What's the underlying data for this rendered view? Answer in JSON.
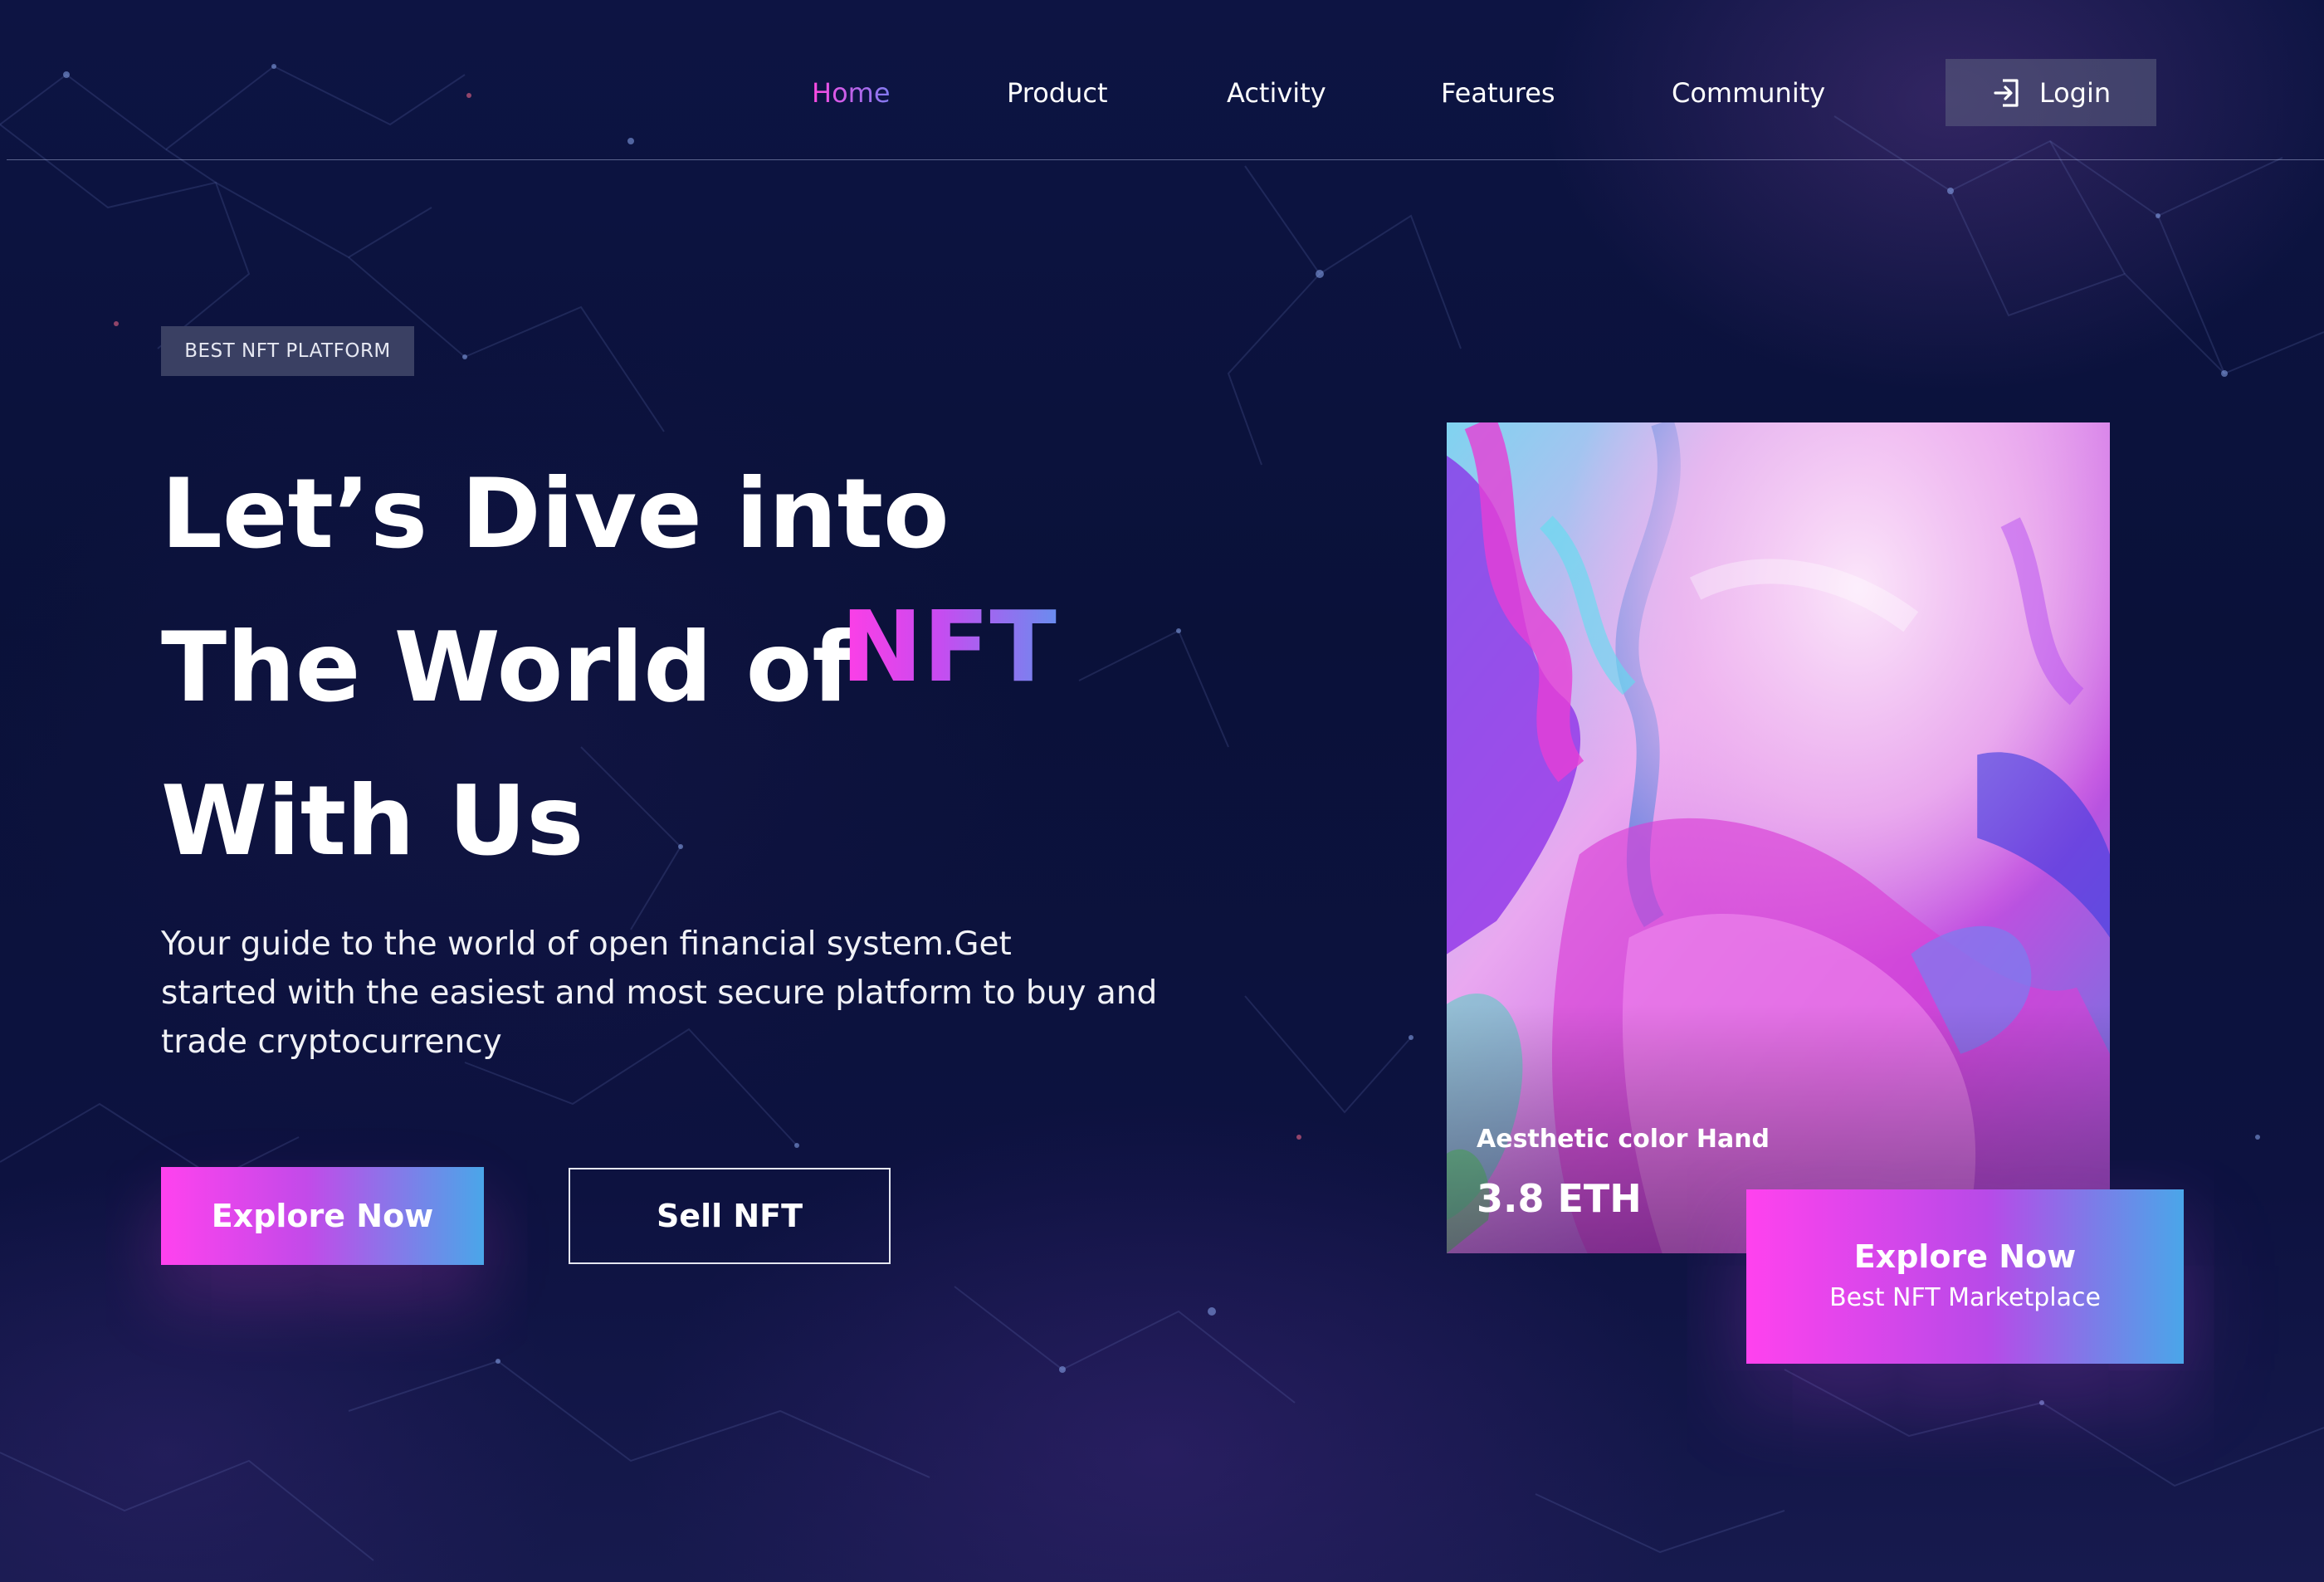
{
  "nav": {
    "items": [
      {
        "label": "Home",
        "active": true
      },
      {
        "label": "Product",
        "active": false
      },
      {
        "label": "Activity",
        "active": false
      },
      {
        "label": "Features",
        "active": false
      },
      {
        "label": "Community",
        "active": false
      }
    ],
    "login_label": "Login",
    "login_icon": "login-icon",
    "active_color": "#ff4ae2"
  },
  "hero": {
    "badge": "BEST NFT PLATFORM",
    "headline_line1": "Let’s Dive into",
    "headline_line2": "The World of",
    "headline_highlight": "NFT",
    "headline_line3": "With Us",
    "description_lines": [
      "Your guide to the world of open financial system.Get",
      "started with the easiest and most secure platform to buy and",
      "trade cryptocurrency"
    ],
    "primary_button": "Explore Now",
    "secondary_button": "Sell NFT"
  },
  "featured": {
    "name": "Aesthetic color Hand",
    "price": "3.8 ETH",
    "cta_title": "Explore Now",
    "cta_subtitle": "Best NFT Marketplace"
  },
  "colors": {
    "background": "#0b1240",
    "gradient_pink": "#ff42ee",
    "gradient_blue": "#4aa6e9",
    "badge_bg": "#3a4063"
  }
}
